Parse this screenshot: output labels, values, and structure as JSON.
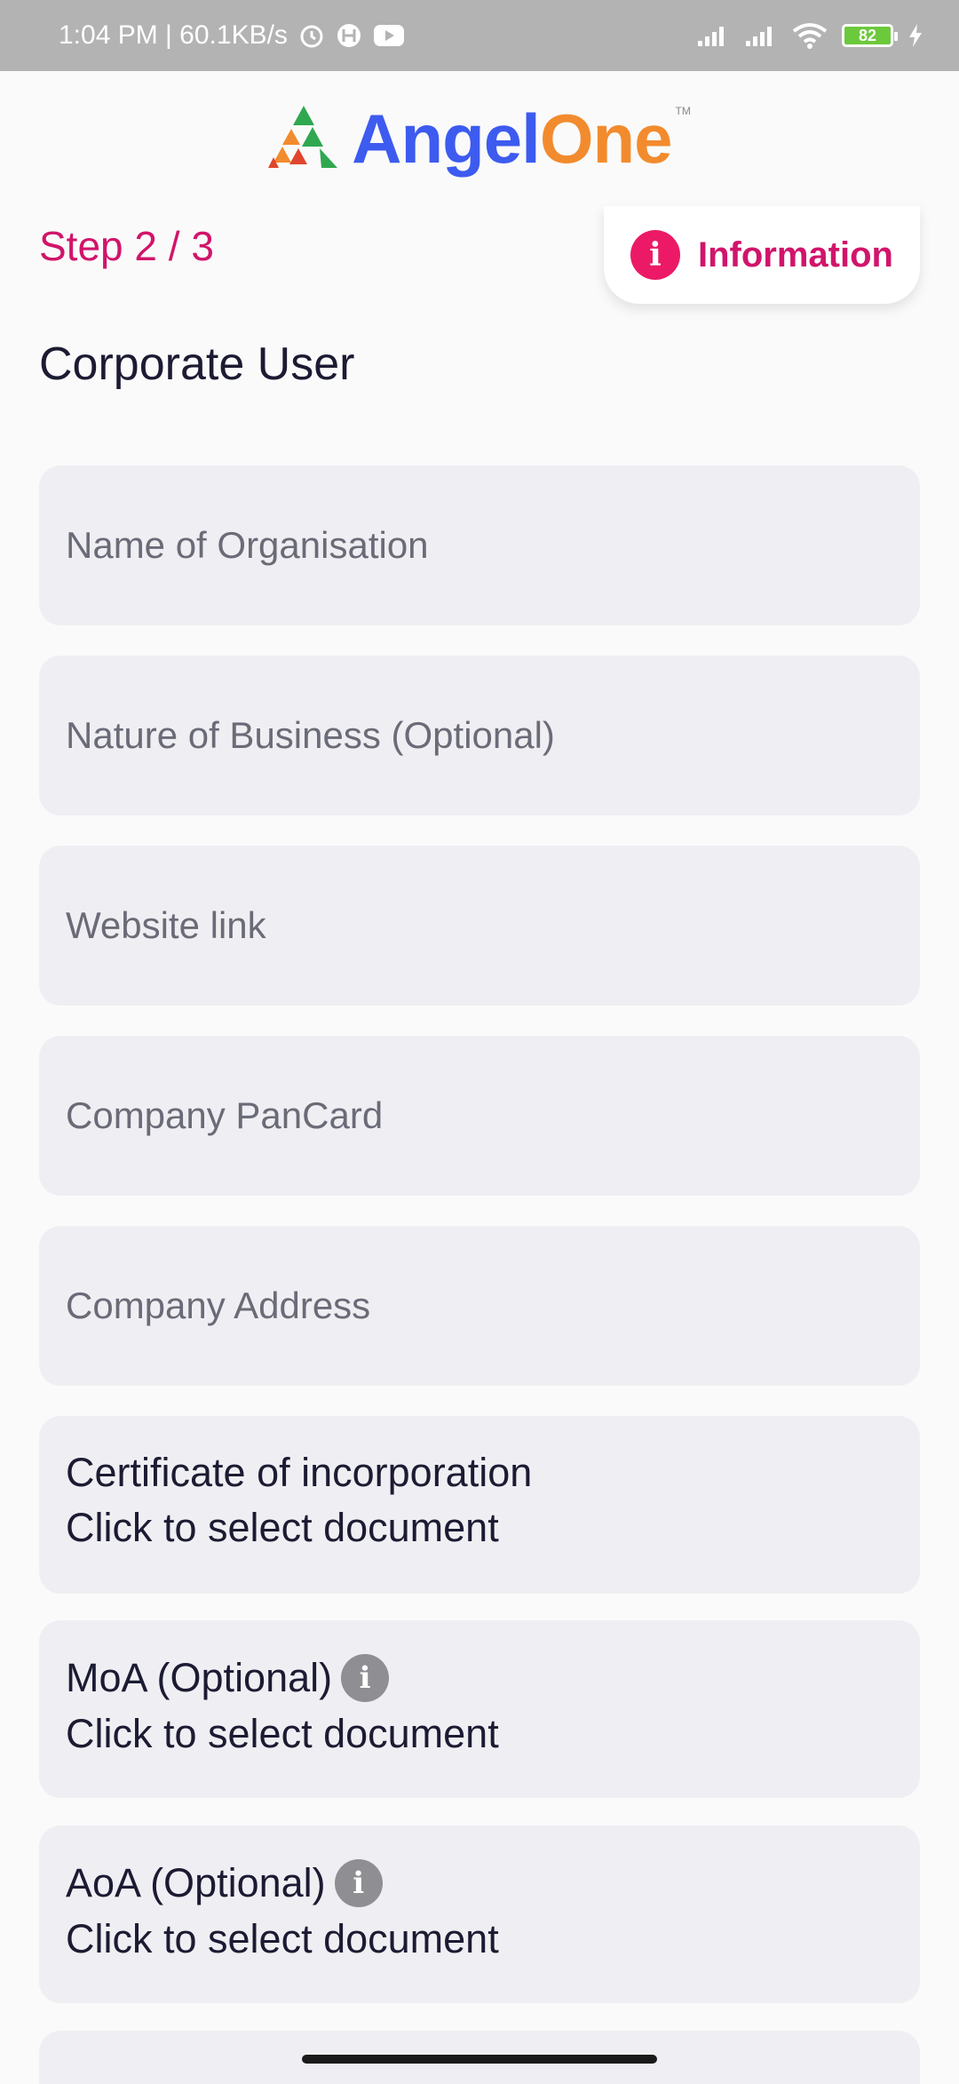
{
  "status_bar": {
    "time_speed": "1:04 PM | 60.1KB/s",
    "battery": "82"
  },
  "brand": {
    "part1": "Angel",
    "part2": "One",
    "tm": "TM"
  },
  "step": {
    "label": "Step 2 / 3"
  },
  "info_button": {
    "icon": "i",
    "label": "Information"
  },
  "page_title": "Corporate User",
  "fields": [
    {
      "placeholder": "Name of Organisation"
    },
    {
      "placeholder": "Nature of Business (Optional)"
    },
    {
      "placeholder": "Website link"
    },
    {
      "placeholder": "Company PanCard"
    },
    {
      "placeholder": "Company Address"
    }
  ],
  "documents": [
    {
      "title": "Certificate of incorporation",
      "action": "Click to select document"
    },
    {
      "title": "MoA (Optional)",
      "action": "Click to select document",
      "info_icon": "i"
    },
    {
      "title": "AoA (Optional)",
      "action": "Click to select document",
      "info_icon": "i"
    }
  ],
  "colors": {
    "accent": "#d1146b",
    "info_icon_bg": "#ec1a66",
    "field_bg": "#efeff3",
    "brand_blue": "#3d5bef",
    "brand_orange": "#f28b2e"
  }
}
